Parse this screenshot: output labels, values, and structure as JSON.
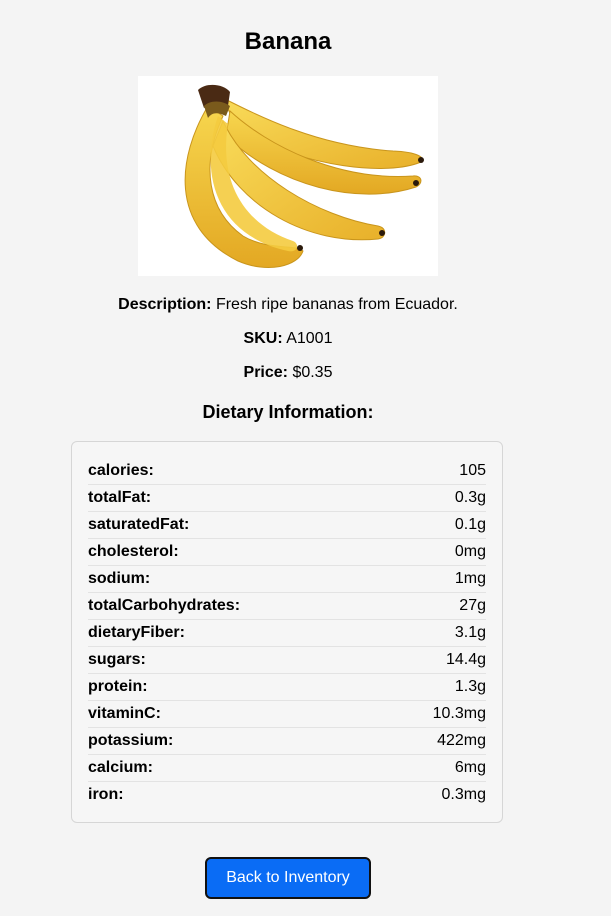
{
  "product": {
    "title": "Banana",
    "image_alt": "banana-bunch",
    "description_label": "Description:",
    "description": "Fresh ripe bananas from Ecuador.",
    "sku_label": "SKU:",
    "sku": "A1001",
    "price_label": "Price:",
    "price": "$0.35"
  },
  "dietary": {
    "heading": "Dietary Information:",
    "rows": [
      {
        "key": "calories:",
        "value": "105"
      },
      {
        "key": "totalFat:",
        "value": "0.3g"
      },
      {
        "key": "saturatedFat:",
        "value": "0.1g"
      },
      {
        "key": "cholesterol:",
        "value": "0mg"
      },
      {
        "key": "sodium:",
        "value": "1mg"
      },
      {
        "key": "totalCarbohydrates:",
        "value": "27g"
      },
      {
        "key": "dietaryFiber:",
        "value": "3.1g"
      },
      {
        "key": "sugars:",
        "value": "14.4g"
      },
      {
        "key": "protein:",
        "value": "1.3g"
      },
      {
        "key": "vitaminC:",
        "value": "10.3mg"
      },
      {
        "key": "potassium:",
        "value": "422mg"
      },
      {
        "key": "calcium:",
        "value": "6mg"
      },
      {
        "key": "iron:",
        "value": "0.3mg"
      }
    ]
  },
  "actions": {
    "back_label": "Back to Inventory"
  },
  "colors": {
    "page_bg": "#f4f4f4",
    "button_bg": "#0a6cf5",
    "banana_yellow": "#f2c23a",
    "banana_shadow": "#d9a520",
    "stem_brown": "#4a2a14"
  }
}
